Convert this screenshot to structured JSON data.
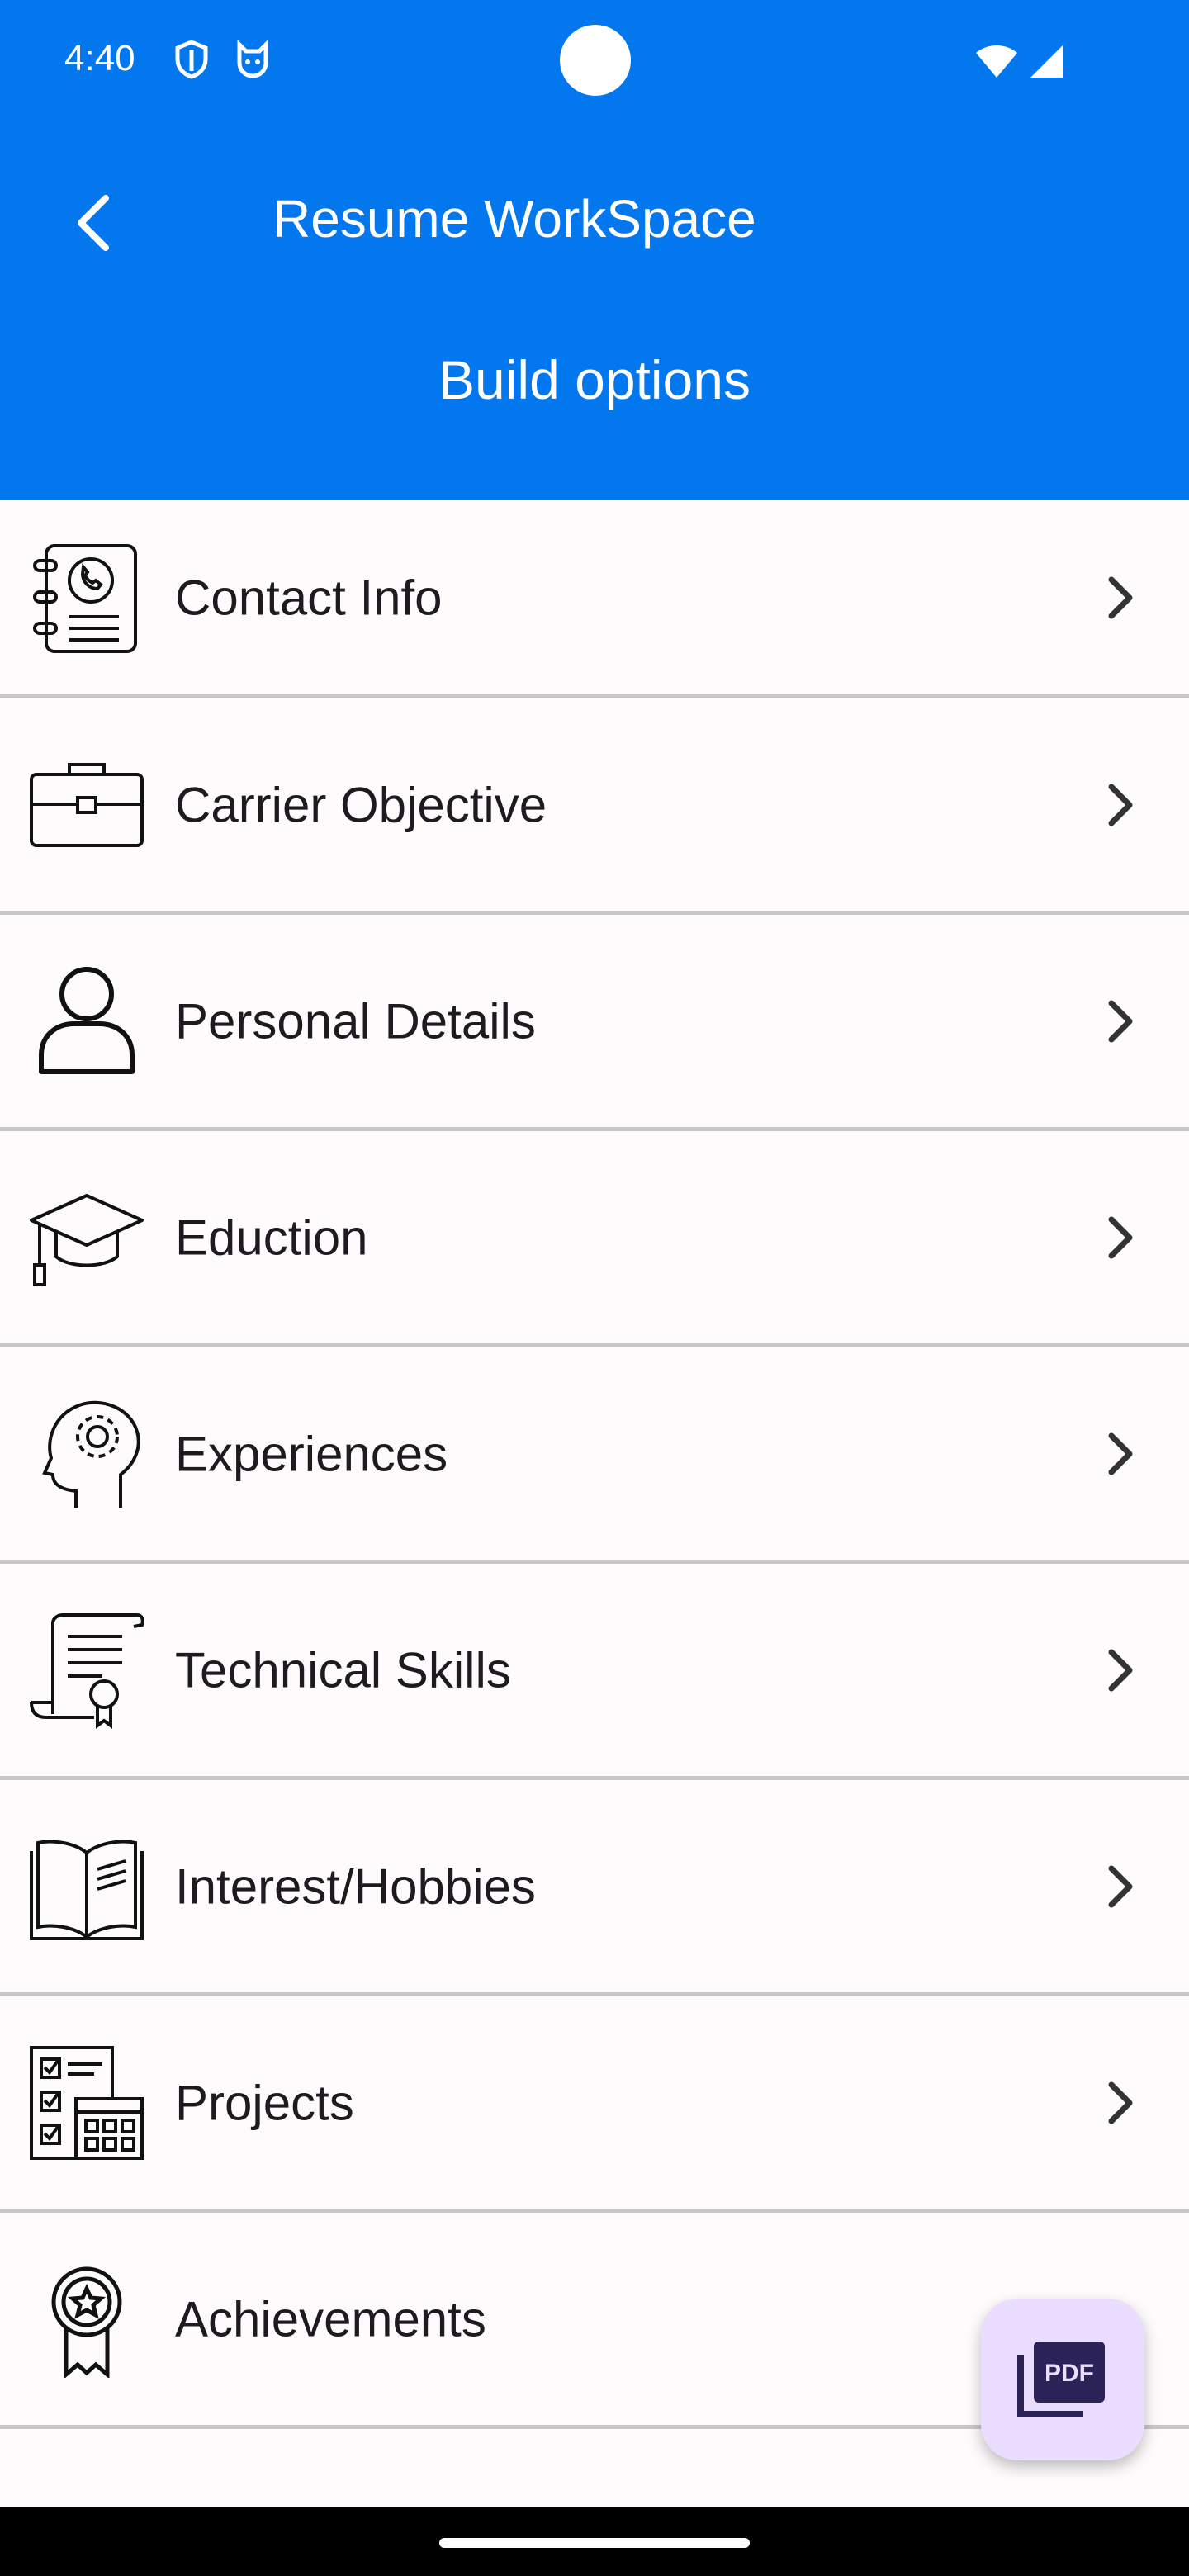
{
  "status_bar": {
    "time": "4:40",
    "left_icons": [
      "shield-icon",
      "cat-face-icon"
    ],
    "right_icons": [
      "wifi-icon",
      "cell-signal-icon"
    ]
  },
  "header": {
    "title": "Resume WorkSpace",
    "subtitle": "Build options",
    "color": "#0277ee"
  },
  "options": [
    {
      "label": "Contact Info",
      "icon": "contact-book-icon"
    },
    {
      "label": "Carrier Objective",
      "icon": "briefcase-icon"
    },
    {
      "label": "Personal Details",
      "icon": "person-icon"
    },
    {
      "label": "Eduction",
      "icon": "graduation-cap-icon"
    },
    {
      "label": "Experiences",
      "icon": "head-gear-icon"
    },
    {
      "label": "Technical Skills",
      "icon": "certificate-scroll-icon"
    },
    {
      "label": "Interest/Hobbies",
      "icon": "open-book-icon"
    },
    {
      "label": "Projects",
      "icon": "checklist-calendar-icon"
    },
    {
      "label": "Achievements",
      "icon": "award-ribbon-icon"
    }
  ],
  "fab": {
    "icon": "pdf-icon",
    "text": "PDF",
    "color": "#eaddff"
  }
}
